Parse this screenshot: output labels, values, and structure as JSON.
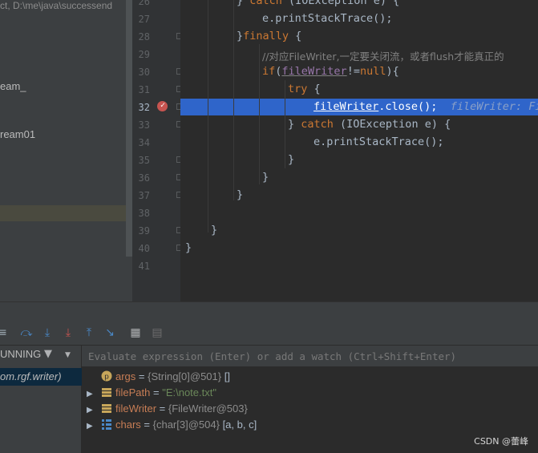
{
  "project": {
    "items": [
      "ct, D:\\me\\java\\successend",
      "eam_",
      "ream01"
    ]
  },
  "gutter": {
    "lines": [
      "26",
      "27",
      "28",
      "29",
      "30",
      "31",
      "32",
      "33",
      "34",
      "35",
      "36",
      "37",
      "38",
      "39",
      "40",
      "41"
    ],
    "current_line": "32"
  },
  "code": {
    "l26": [
      "} ",
      "catch",
      " (IOException e) {"
    ],
    "l27": "e.printStackTrace();",
    "l28": [
      "}",
      "finally",
      " {"
    ],
    "l29": "//对应FileWriter,一定要关闭流，或者flush才能真正的",
    "l30": [
      "if",
      "(",
      "fileWriter",
      "!=",
      "null",
      "){"
    ],
    "l31": [
      "try",
      " {"
    ],
    "l32": [
      "fileWriter",
      ".close();"
    ],
    "l32_inline": "fileWriter: Fi",
    "l33": [
      "} ",
      "catch",
      " (IOException e) {"
    ],
    "l34": "e.printStackTrace();",
    "l35": "}",
    "l36": "}",
    "l37": "}",
    "l39": "}",
    "l40": "}"
  },
  "toolbar": {
    "icons": [
      "step-over-icon",
      "step-into-icon",
      "force-step-into-icon",
      "step-out-icon",
      "run-to-cursor-icon",
      "evaluate-icon",
      "trace-icon"
    ]
  },
  "frames": {
    "header": "UNNING",
    "selected": "om.rgf.writer)"
  },
  "variables": {
    "eval_placeholder": "Evaluate expression (Enter) or add a watch (Ctrl+Shift+Enter)",
    "rows": [
      {
        "name": "args",
        "eq": " = ",
        "type": "{String[0]@501}",
        "value": " []",
        "icon": "parameter-icon",
        "expandable": false
      },
      {
        "name": "filePath",
        "eq": " = ",
        "type": "",
        "value": "\"E:\\note.txt\"",
        "icon": "field-icon",
        "expandable": true
      },
      {
        "name": "fileWriter",
        "eq": " = ",
        "type": "{FileWriter@503}",
        "value": "",
        "icon": "field-icon",
        "expandable": true
      },
      {
        "name": "chars",
        "eq": " = ",
        "type": "{char[3]@504}",
        "value": " [a, b, c]",
        "icon": "array-icon",
        "expandable": true
      }
    ]
  },
  "watermark": "CSDN @蕾峰",
  "colors": {
    "highlight_line": "#2f65ca",
    "keyword": "#cc7832",
    "field": "#9876aa",
    "string": "#6a8759",
    "breakpoint": "#c75450"
  }
}
